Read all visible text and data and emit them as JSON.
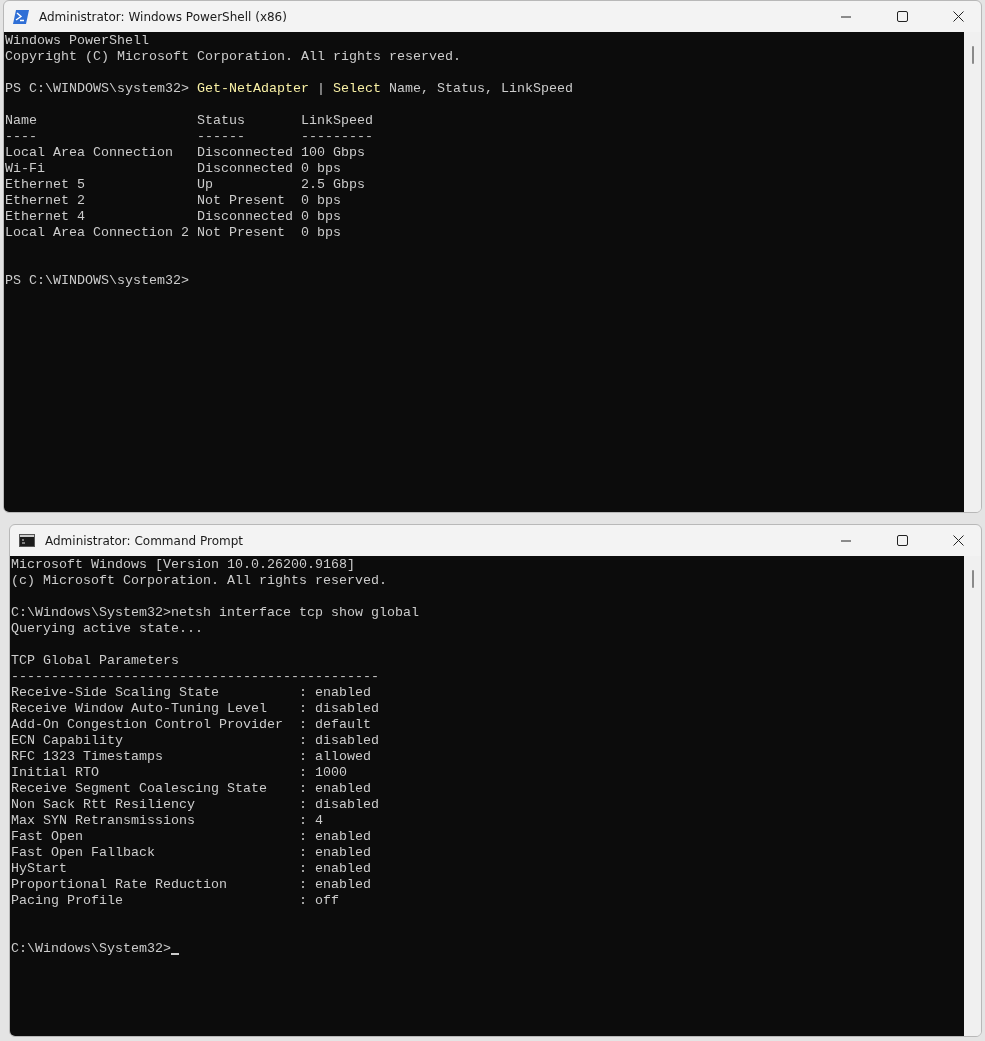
{
  "powershell": {
    "title": "Administrator: Windows PowerShell (x86)",
    "banner": [
      "Windows PowerShell",
      "Copyright (C) Microsoft Corporation. All rights reserved."
    ],
    "prompt": "PS C:\\WINDOWS\\system32> ",
    "command_tokens": [
      {
        "text": "Get-NetAdapter",
        "kind": "command"
      },
      {
        "text": " | ",
        "kind": "operator"
      },
      {
        "text": "Select",
        "kind": "command"
      },
      {
        "text": " Name, Status, LinkSpeed",
        "kind": "argument"
      }
    ],
    "table": {
      "columns": [
        "Name",
        "Status",
        "LinkSpeed"
      ],
      "rules": [
        "----",
        "------",
        "---------"
      ],
      "rows": [
        [
          "Local Area Connection",
          "Disconnected",
          "100 Gbps"
        ],
        [
          "Wi-Fi",
          "Disconnected",
          "0 bps"
        ],
        [
          "Ethernet 5",
          "Up",
          "2.5 Gbps"
        ],
        [
          "Ethernet 2",
          "Not Present",
          "0 bps"
        ],
        [
          "Ethernet 4",
          "Disconnected",
          "0 bps"
        ],
        [
          "Local Area Connection 2",
          "Not Present",
          "0 bps"
        ]
      ]
    },
    "final_prompt": "PS C:\\WINDOWS\\system32>"
  },
  "cmd": {
    "title": "Administrator: Command Prompt",
    "banner": [
      "Microsoft Windows [Version 10.0.26200.9168]",
      "(c) Microsoft Corporation. All rights reserved."
    ],
    "command_line": "C:\\Windows\\System32>netsh interface tcp show global",
    "status": "Querying active state...",
    "heading": "TCP Global Parameters",
    "rule": "----------------------------------------------",
    "parameters": [
      {
        "name": "Receive-Side Scaling State",
        "separator": ":",
        "value": "enabled"
      },
      {
        "name": "Receive Window Auto-Tuning Level",
        "separator": ":",
        "value": "disabled"
      },
      {
        "name": "Add-On Congestion Control Provider",
        "separator": ":",
        "value": "default"
      },
      {
        "name": "ECN Capability",
        "separator": ":",
        "value": "disabled"
      },
      {
        "name": "RFC 1323 Timestamps",
        "separator": ":",
        "value": "allowed"
      },
      {
        "name": "Initial RTO",
        "separator": ":",
        "value": "1000"
      },
      {
        "name": "Receive Segment Coalescing State",
        "separator": ":",
        "value": "enabled"
      },
      {
        "name": "Non Sack Rtt Resiliency",
        "separator": ":",
        "value": "disabled"
      },
      {
        "name": "Max SYN Retransmissions",
        "separator": ":",
        "value": "4"
      },
      {
        "name": "Fast Open",
        "separator": ":",
        "value": "enabled"
      },
      {
        "name": "Fast Open Fallback",
        "separator": ":",
        "value": "enabled"
      },
      {
        "name": "HyStart",
        "separator": ":",
        "value": "enabled"
      },
      {
        "name": "Proportional Rate Reduction",
        "separator": ":",
        "value": "enabled"
      },
      {
        "name": "Pacing Profile",
        "separator": ":",
        "value": "off"
      }
    ],
    "final_prompt": "C:\\Windows\\System32>"
  }
}
